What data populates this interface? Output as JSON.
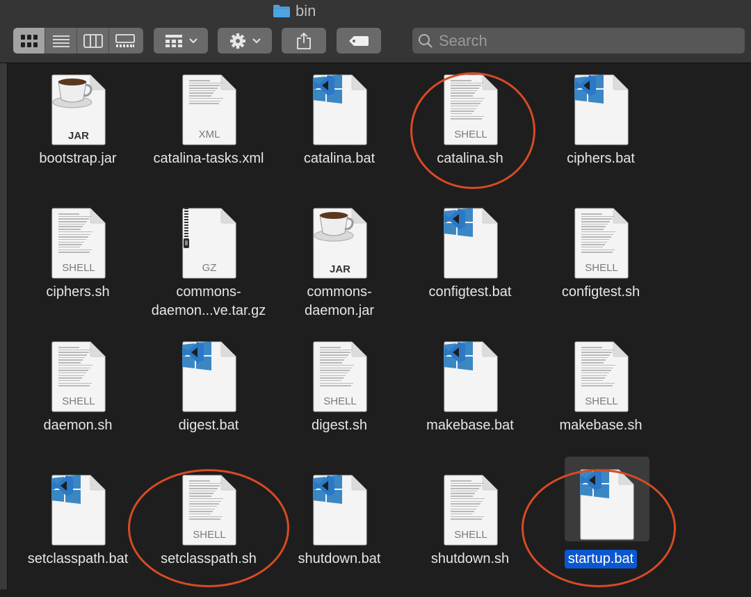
{
  "window": {
    "title": "bin"
  },
  "toolbar": {
    "view_modes": [
      "icon-view",
      "list-view",
      "column-view",
      "gallery-view"
    ],
    "active_view": "icon-view",
    "group_button": "grid-group-icon",
    "action_button": "gear-icon",
    "share_button": "share-icon",
    "tag_button": "tag-icon"
  },
  "search": {
    "placeholder": "Search",
    "value": ""
  },
  "files": [
    {
      "name": "bootstrap.jar",
      "type": "jar",
      "badge": "JAR"
    },
    {
      "name": "catalina-tasks.xml",
      "type": "doc",
      "badge": "XML"
    },
    {
      "name": "catalina.bat",
      "type": "bat",
      "badge": ""
    },
    {
      "name": "catalina.sh",
      "type": "doc",
      "badge": "SHELL"
    },
    {
      "name": "ciphers.bat",
      "type": "bat",
      "badge": ""
    },
    {
      "name": "ciphers.sh",
      "type": "doc",
      "badge": "SHELL"
    },
    {
      "name": "commons-daemon...ve.tar.gz",
      "type": "gz",
      "badge": "GZ"
    },
    {
      "name": "commons-daemon.jar",
      "type": "jar",
      "badge": "JAR"
    },
    {
      "name": "configtest.bat",
      "type": "bat",
      "badge": ""
    },
    {
      "name": "configtest.sh",
      "type": "doc",
      "badge": "SHELL"
    },
    {
      "name": "daemon.sh",
      "type": "doc",
      "badge": "SHELL"
    },
    {
      "name": "digest.bat",
      "type": "bat",
      "badge": ""
    },
    {
      "name": "digest.sh",
      "type": "doc",
      "badge": "SHELL"
    },
    {
      "name": "makebase.bat",
      "type": "bat",
      "badge": ""
    },
    {
      "name": "makebase.sh",
      "type": "doc",
      "badge": "SHELL"
    },
    {
      "name": "setclasspath.bat",
      "type": "bat",
      "badge": ""
    },
    {
      "name": "setclasspath.sh",
      "type": "doc",
      "badge": "SHELL"
    },
    {
      "name": "shutdown.bat",
      "type": "bat",
      "badge": ""
    },
    {
      "name": "shutdown.sh",
      "type": "doc",
      "badge": "SHELL"
    },
    {
      "name": "startup.bat",
      "type": "bat",
      "badge": "",
      "selected": true
    }
  ],
  "highlighted_files": [
    "catalina.sh",
    "setclasspath.sh",
    "startup.bat"
  ],
  "colors": {
    "annotation_circle": "#d84a25",
    "selection": "#0b57d0",
    "windows_logo": "#3b87c4",
    "vscode_badge": "#2a78c6"
  }
}
